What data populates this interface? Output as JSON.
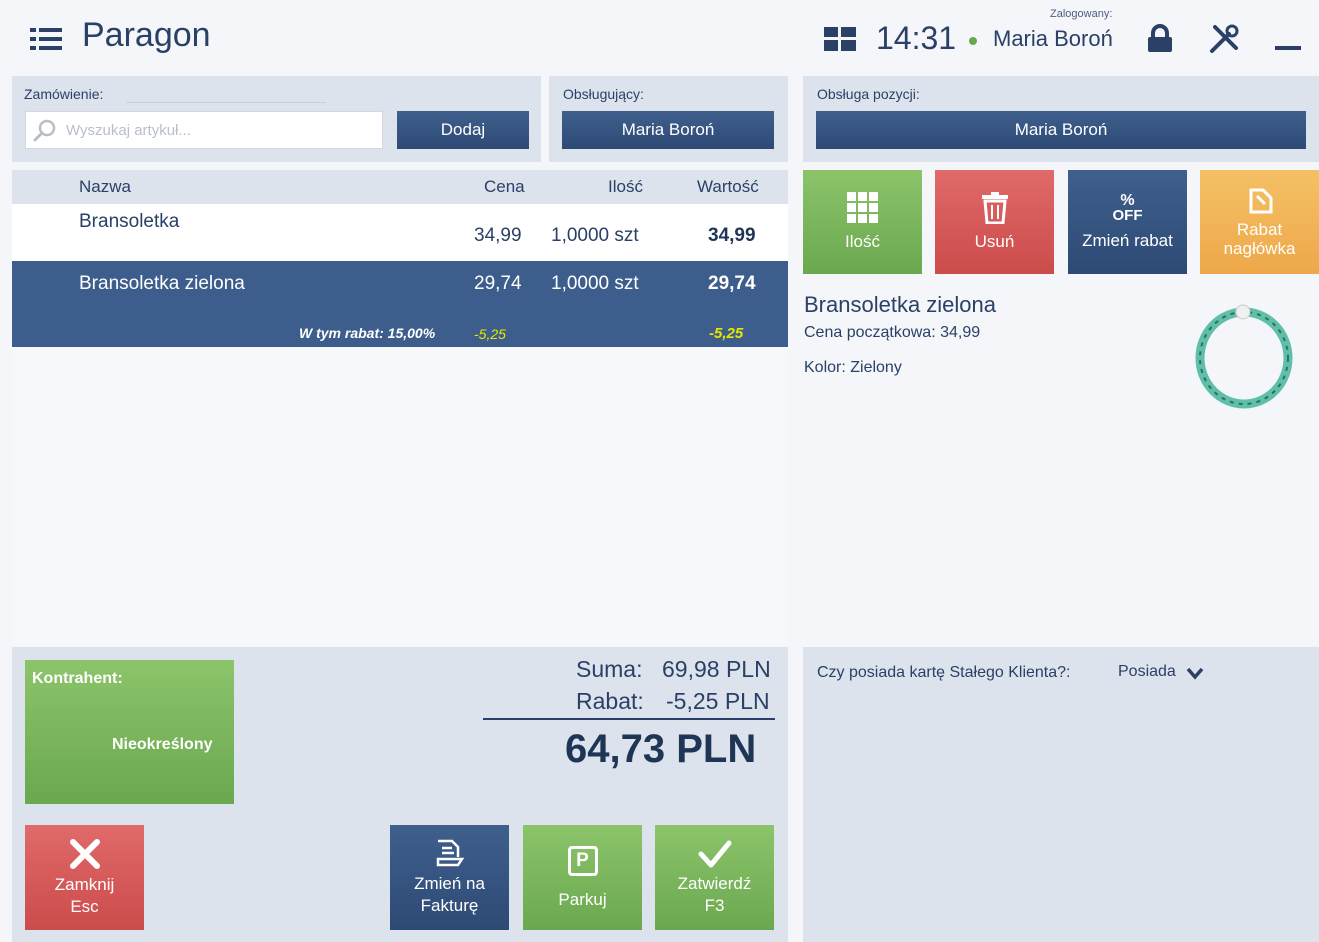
{
  "header": {
    "title": "Paragon",
    "time": "14:31",
    "logged_caption": "Zalogowany:",
    "user": "Maria Boroń",
    "status_color": "#6aa84f"
  },
  "order": {
    "label": "Zamówienie:",
    "search_placeholder": "Wyszukaj artykuł...",
    "add_label": "Dodaj"
  },
  "waiter": {
    "label": "Obsługujący:",
    "value": "Maria Boroń"
  },
  "position_service": {
    "label": "Obsługa pozycji:",
    "value": "Maria Boroń"
  },
  "table": {
    "columns": [
      "Nazwa",
      "Cena",
      "Ilość",
      "Wartość"
    ],
    "rows": [
      {
        "name": "Bransoletka",
        "price": "34,99",
        "qty": "1,0000 szt",
        "value": "34,99"
      },
      {
        "name": "Bransoletka zielona",
        "price": "29,74",
        "qty": "1,0000 szt",
        "value": "29,74",
        "discount_label": "W tym rabat: 15,00%",
        "discount_price": "-5,25",
        "discount_value": "-5,25"
      }
    ]
  },
  "actions": {
    "qty": "Ilość",
    "delete": "Usuń",
    "discount_icon_top": "%",
    "discount_icon_bottom": "OFF",
    "discount": "Zmień rabat",
    "header_discount_1": "Rabat",
    "header_discount_2": "nagłówka"
  },
  "product": {
    "name": "Bransoletka zielona",
    "price_line": "Cena początkowa: 34,99",
    "color_line": "Kolor: Zielony"
  },
  "contractor": {
    "label": "Kontrahent:",
    "value": "Nieokreślony"
  },
  "summary": {
    "sum_label": "Suma:",
    "sum_value": "69,98 PLN",
    "discount_label": "Rabat:",
    "discount_value": "-5,25 PLN",
    "total": "64,73 PLN"
  },
  "footer_buttons": {
    "close_1": "Zamknij",
    "close_2": "Esc",
    "invoice_1": "Zmień na",
    "invoice_2": "Fakturę",
    "park": "Parkuj",
    "park_icon": "P",
    "confirm_1": "Zatwierdź",
    "confirm_2": "F3"
  },
  "loyalty": {
    "question": "Czy posiada kartę Stałego Klienta?:",
    "value": "Posiada"
  },
  "colors": {
    "accent_blue": "#3d5e8c",
    "green": "#6aa84f",
    "red": "#cc4b4b",
    "orange": "#eea84a",
    "discount_yellow": "#e6e600"
  }
}
